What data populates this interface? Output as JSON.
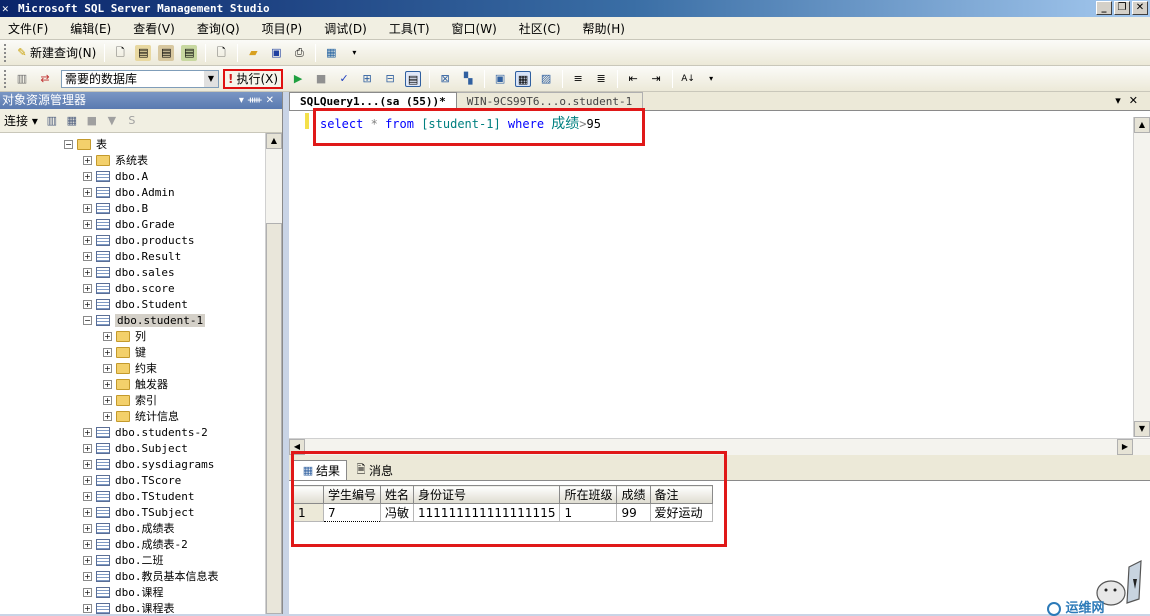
{
  "window": {
    "title": "Microsoft SQL Server Management Studio"
  },
  "menu": [
    "文件(F)",
    "编辑(E)",
    "查看(V)",
    "查询(Q)",
    "项目(P)",
    "调试(D)",
    "工具(T)",
    "窗口(W)",
    "社区(C)",
    "帮助(H)"
  ],
  "toolbar1": {
    "new_query": "新建查询(N)"
  },
  "toolbar2": {
    "database": "需要的数据库",
    "execute": "执行(X)"
  },
  "object_explorer": {
    "title": "对象资源管理器",
    "connect": "连接",
    "tables_folder": "表",
    "nodes": [
      {
        "label": "系统表",
        "kind": "folder",
        "level": 0
      },
      {
        "label": "dbo.A",
        "kind": "table",
        "level": 0
      },
      {
        "label": "dbo.Admin",
        "kind": "table",
        "level": 0
      },
      {
        "label": "dbo.B",
        "kind": "table",
        "level": 0
      },
      {
        "label": "dbo.Grade",
        "kind": "table",
        "level": 0
      },
      {
        "label": "dbo.products",
        "kind": "table",
        "level": 0
      },
      {
        "label": "dbo.Result",
        "kind": "table",
        "level": 0
      },
      {
        "label": "dbo.sales",
        "kind": "table",
        "level": 0
      },
      {
        "label": "dbo.score",
        "kind": "table",
        "level": 0
      },
      {
        "label": "dbo.Student",
        "kind": "table",
        "level": 0
      },
      {
        "label": "dbo.student-1",
        "kind": "table",
        "level": 0,
        "expanded": true,
        "selected": true
      },
      {
        "label": "列",
        "kind": "folder",
        "level": 1
      },
      {
        "label": "键",
        "kind": "folder",
        "level": 1
      },
      {
        "label": "约束",
        "kind": "folder",
        "level": 1
      },
      {
        "label": "触发器",
        "kind": "folder",
        "level": 1
      },
      {
        "label": "索引",
        "kind": "folder",
        "level": 1
      },
      {
        "label": "统计信息",
        "kind": "folder",
        "level": 1
      },
      {
        "label": "dbo.students-2",
        "kind": "table",
        "level": 0
      },
      {
        "label": "dbo.Subject",
        "kind": "table",
        "level": 0
      },
      {
        "label": "dbo.sysdiagrams",
        "kind": "table",
        "level": 0
      },
      {
        "label": "dbo.TScore",
        "kind": "table",
        "level": 0
      },
      {
        "label": "dbo.TStudent",
        "kind": "table",
        "level": 0
      },
      {
        "label": "dbo.TSubject",
        "kind": "table",
        "level": 0
      },
      {
        "label": "dbo.成绩表",
        "kind": "table",
        "level": 0
      },
      {
        "label": "dbo.成绩表-2",
        "kind": "table",
        "level": 0
      },
      {
        "label": "dbo.二班",
        "kind": "table",
        "level": 0
      },
      {
        "label": "dbo.教员基本信息表",
        "kind": "table",
        "level": 0
      },
      {
        "label": "dbo.课程",
        "kind": "table",
        "level": 0
      },
      {
        "label": "dbo.课程表",
        "kind": "table",
        "level": 0
      }
    ]
  },
  "editor": {
    "tabs": [
      "SQLQuery1...(sa (55))*",
      "WIN-9CS99T6...o.student-1"
    ],
    "sql": {
      "kw1": "select",
      "star": "*",
      "kw2": "from",
      "table": "[student-1]",
      "kw3": "where",
      "col": "成绩",
      "op": ">",
      "val": "95"
    }
  },
  "results": {
    "tabs": [
      "结果",
      "消息"
    ],
    "columns": [
      "学生编号",
      "姓名",
      "身份证号",
      "所在班级",
      "成绩",
      "备注"
    ],
    "rows": [
      [
        "1",
        "7",
        "冯敏",
        "111111111111111115",
        "1",
        "99",
        "爱好运动"
      ]
    ]
  },
  "watermark": "运维网"
}
